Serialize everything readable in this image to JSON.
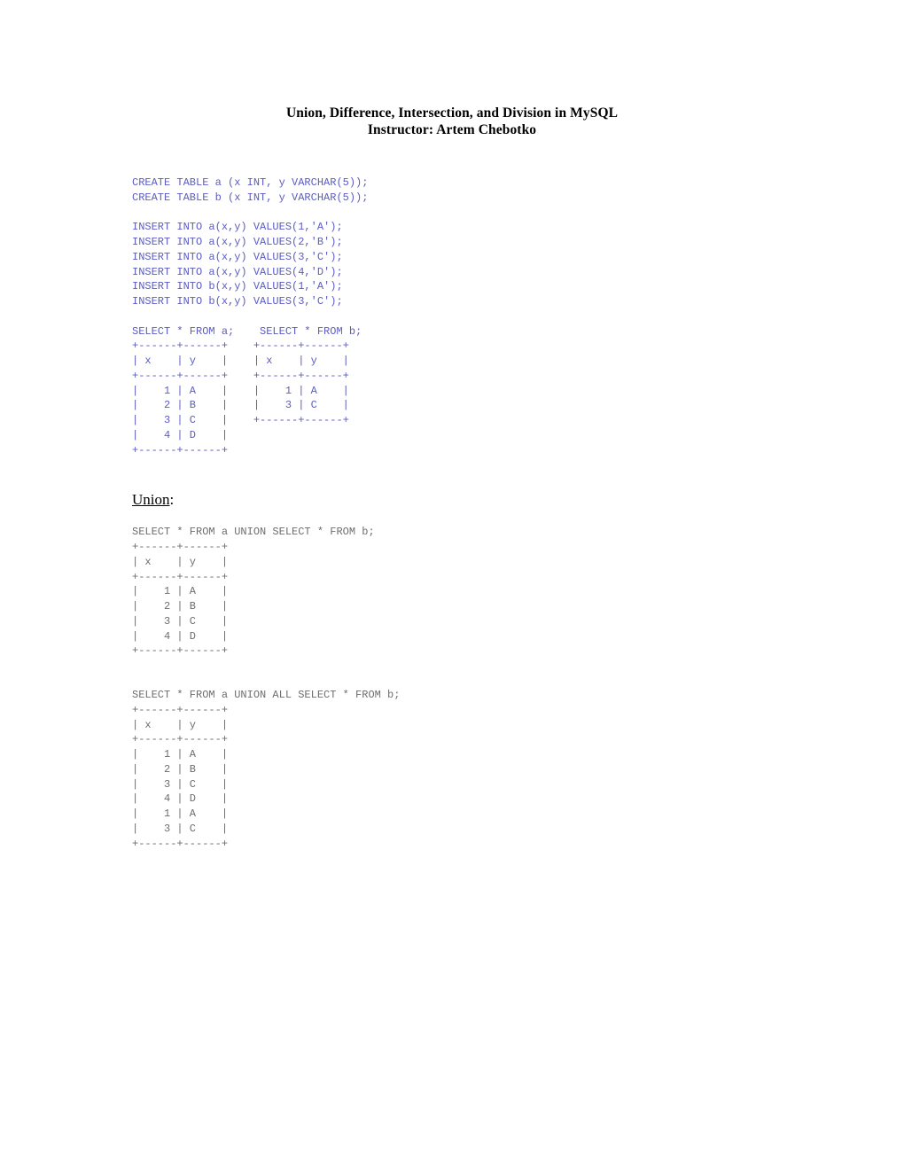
{
  "document": {
    "title_line_1": "Union, Difference, Intersection, and Division in MySQL",
    "title_line_2": "Instructor: Artem Chebotko"
  },
  "colors": {
    "code_blue": "#5b5cc4",
    "code_gray": "#6e6e6e",
    "text_black": "#000000",
    "page_background": "#ffffff"
  },
  "setup_block": {
    "color": "#5b5cc4",
    "text": "CREATE TABLE a (x INT, y VARCHAR(5));\nCREATE TABLE b (x INT, y VARCHAR(5));\n\nINSERT INTO a(x,y) VALUES(1,'A');\nINSERT INTO a(x,y) VALUES(2,'B');\nINSERT INTO a(x,y) VALUES(3,'C');\nINSERT INTO a(x,y) VALUES(4,'D');\nINSERT INTO b(x,y) VALUES(1,'A');\nINSERT INTO b(x,y) VALUES(3,'C');\n\nSELECT * FROM a;    SELECT * FROM b;\n+------+------+    +------+------+\n| x    | y    |    | x    | y    |\n+------+------+    +------+------+\n|    1 | A    |    |    1 | A    |\n|    2 | B    |    |    3 | C    |\n|    3 | C    |    +------+------+\n|    4 | D    |\n+------+------+",
    "statements": [
      "CREATE TABLE a (x INT, y VARCHAR(5));",
      "CREATE TABLE b (x INT, y VARCHAR(5));",
      "INSERT INTO a(x,y) VALUES(1,'A');",
      "INSERT INTO a(x,y) VALUES(2,'B');",
      "INSERT INTO a(x,y) VALUES(3,'C');",
      "INSERT INTO a(x,y) VALUES(4,'D');",
      "INSERT INTO b(x,y) VALUES(1,'A');",
      "INSERT INTO b(x,y) VALUES(3,'C');",
      "SELECT * FROM a;",
      "SELECT * FROM b;"
    ],
    "result_table_a": {
      "query": "SELECT * FROM a;",
      "columns": [
        "x",
        "y"
      ],
      "rows": [
        [
          "1",
          "A"
        ],
        [
          "2",
          "B"
        ],
        [
          "3",
          "C"
        ],
        [
          "4",
          "D"
        ]
      ]
    },
    "result_table_b": {
      "query": "SELECT * FROM b;",
      "columns": [
        "x",
        "y"
      ],
      "rows": [
        [
          "1",
          "A"
        ],
        [
          "3",
          "C"
        ]
      ]
    }
  },
  "section_union": {
    "heading_text": "Union",
    "heading_colon": ":"
  },
  "union_block": {
    "color": "#6e6e6e",
    "text": "SELECT * FROM a UNION SELECT * FROM b;\n+------+------+\n| x    | y    |\n+------+------+\n|    1 | A    |\n|    2 | B    |\n|    3 | C    |\n|    4 | D    |\n+------+------+",
    "query": "SELECT * FROM a UNION SELECT * FROM b;",
    "result": {
      "columns": [
        "x",
        "y"
      ],
      "rows": [
        [
          "1",
          "A"
        ],
        [
          "2",
          "B"
        ],
        [
          "3",
          "C"
        ],
        [
          "4",
          "D"
        ]
      ]
    }
  },
  "union_all_block": {
    "color": "#6e6e6e",
    "text": "SELECT * FROM a UNION ALL SELECT * FROM b;\n+------+------+\n| x    | y    |\n+------+------+\n|    1 | A    |\n|    2 | B    |\n|    3 | C    |\n|    4 | D    |\n|    1 | A    |\n|    3 | C    |\n+------+------+",
    "query": "SELECT * FROM a UNION ALL SELECT * FROM b;",
    "result": {
      "columns": [
        "x",
        "y"
      ],
      "rows": [
        [
          "1",
          "A"
        ],
        [
          "2",
          "B"
        ],
        [
          "3",
          "C"
        ],
        [
          "4",
          "D"
        ],
        [
          "1",
          "A"
        ],
        [
          "3",
          "C"
        ]
      ]
    }
  }
}
